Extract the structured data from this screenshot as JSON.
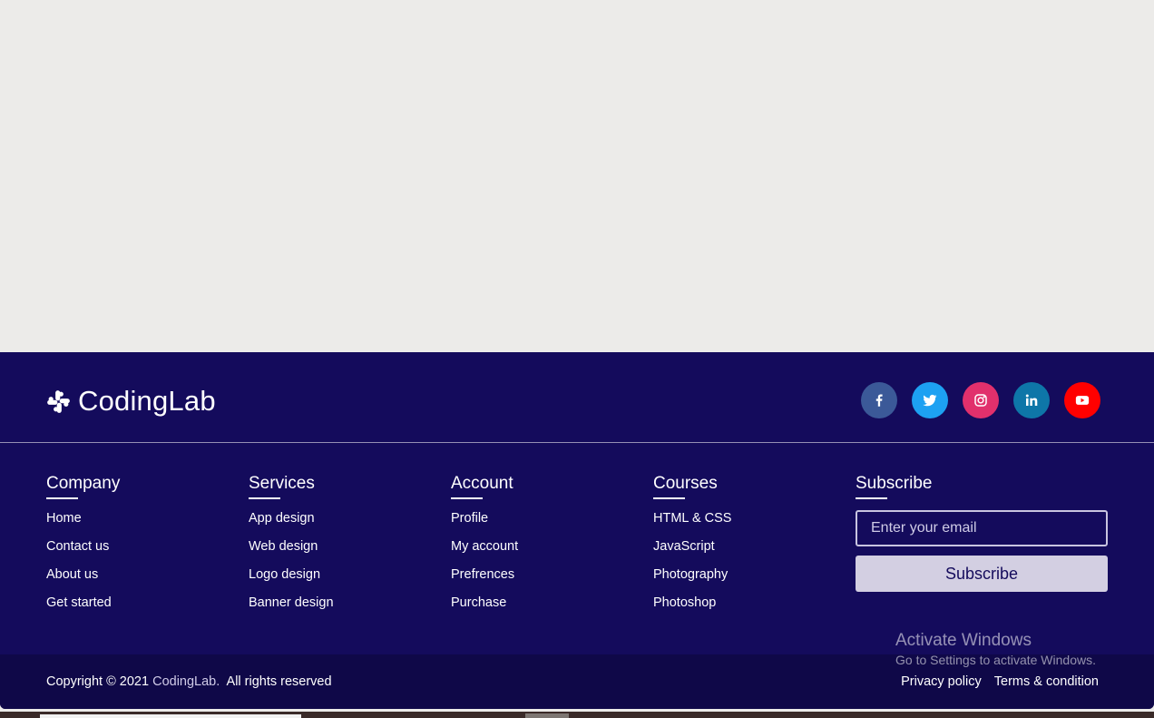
{
  "brand": {
    "name": "CodingLab",
    "color": "#140b5c"
  },
  "socials": [
    {
      "name": "facebook",
      "color": "#3b5998",
      "icon": "facebook-icon"
    },
    {
      "name": "twitter",
      "color": "#1da1f2",
      "icon": "twitter-icon"
    },
    {
      "name": "instagram",
      "color": "#e1306c",
      "icon": "instagram-icon"
    },
    {
      "name": "linkedin",
      "color": "#0e76a8",
      "icon": "linkedin-icon"
    },
    {
      "name": "youtube",
      "color": "#ff0000",
      "icon": "youtube-icon"
    }
  ],
  "columns": {
    "company": {
      "title": "Company",
      "links": [
        "Home",
        "Contact us",
        "About us",
        "Get started"
      ]
    },
    "services": {
      "title": "Services",
      "links": [
        "App design",
        "Web design",
        "Logo design",
        "Banner design"
      ]
    },
    "account": {
      "title": "Account",
      "links": [
        "Profile",
        "My account",
        "Prefrences",
        "Purchase"
      ]
    },
    "courses": {
      "title": "Courses",
      "links": [
        "HTML & CSS",
        "JavaScript",
        "Photography",
        "Photoshop"
      ]
    }
  },
  "subscribe": {
    "title": "Subscribe",
    "placeholder": "Enter your email",
    "button_label": "Subscribe"
  },
  "bottom": {
    "copyright_prefix": "Copyright © 2021 ",
    "copyright_brand": "CodingLab.",
    "copyright_suffix": "  All rights reserved",
    "privacy": "Privacy policy",
    "terms": "Terms & condition"
  },
  "watermark": {
    "line1": "Activate Windows",
    "line2": "Go to Settings to activate Windows."
  }
}
